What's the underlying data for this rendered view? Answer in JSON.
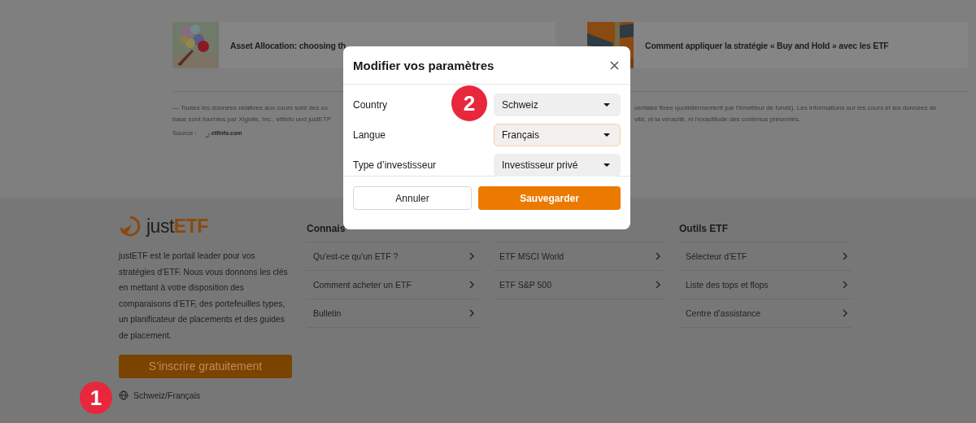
{
  "articles": [
    {
      "title": "Asset Allocation: choosing th"
    },
    {
      "title": "Comment appliquer la stratégie « Buy and Hold » avec les ETF"
    }
  ],
  "disclaimer": {
    "left_lines": [
      "— Toutes les données relatives aux cours sont des co",
      "base sont fournies par Xignite, Inc., etfinfo und justETF"
    ],
    "right_lines": [
      "ventaire fixée quotidiennement par l'émetteur de fonds). Les informations sur les cours et les données de",
      "vité, ni la véracité, ni l'exactitude des contenus présentés."
    ],
    "source_label": "Source :",
    "source_logo": "etfinfo.com"
  },
  "footer": {
    "logo": {
      "prefix": "just",
      "suffix": "ETF"
    },
    "description": "justETF est le portail leader pour vos stratégies d’ETF. Nous vous donnons les clés en mettant à votre disposition des comparaisons d’ETF, des portefeuilles types, un planificateur de placements et des guides de placement.",
    "signup_button": "S’inscrire gratuitement",
    "locale": "Schweiz/Français",
    "columns": [
      {
        "heading": "Connais",
        "links": [
          "Qu'est-ce qu'un ETF ?",
          "Comment acheter un ETF",
          "Bulletin"
        ]
      },
      {
        "links": [
          "ETF MSCI World",
          "ETF S&P 500"
        ]
      },
      {
        "heading": "Outils ETF",
        "links": [
          "Sélecteur d’ETF",
          "Liste des tops et flops",
          "Centre d’assistance"
        ]
      }
    ]
  },
  "modal": {
    "title": "Modifier vos paramètres",
    "fields": [
      {
        "label": "Country",
        "value": "Schweiz",
        "focused": false
      },
      {
        "label": "Langue",
        "value": "Français",
        "focused": true
      },
      {
        "label": "Type d’investisseur",
        "value": "Investisseur privé",
        "focused": false
      }
    ],
    "buttons": [
      {
        "kind": "secondary",
        "label": "Annuler"
      },
      {
        "kind": "primary",
        "label": "Sauvegarder"
      }
    ]
  },
  "markers": [
    {
      "label": "1"
    },
    {
      "label": "2"
    }
  ]
}
